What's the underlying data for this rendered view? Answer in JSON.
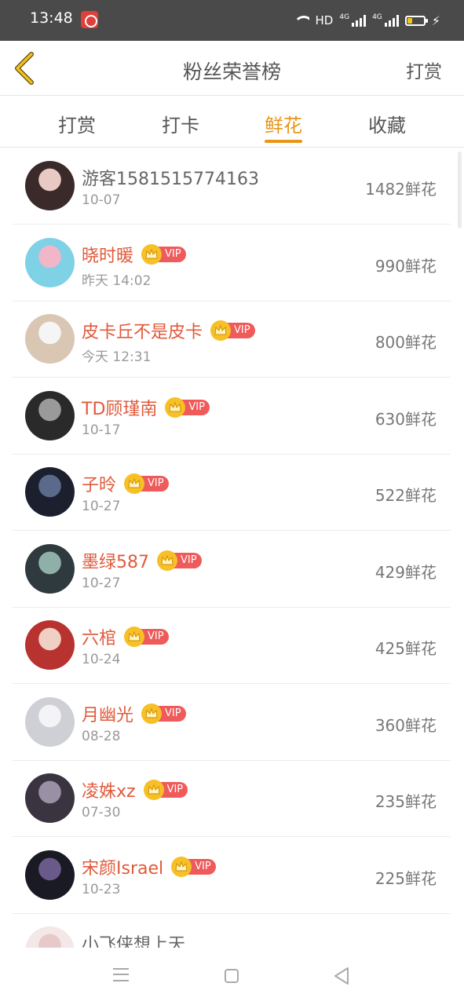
{
  "status": {
    "time": "13:48",
    "hd": "HD",
    "net1": "4G",
    "net2": "4G"
  },
  "header": {
    "title": "粉丝荣誉榜",
    "action": "打赏"
  },
  "tabs": [
    {
      "label": "打赏"
    },
    {
      "label": "打卡"
    },
    {
      "label": "鲜花",
      "active": true
    },
    {
      "label": "收藏"
    }
  ],
  "vip_label": "VIP",
  "colors": {
    "accent": "#e8951b",
    "vip_name": "#e05a3c",
    "vip_badge": "#ef5a5a",
    "crown": "#f6c026"
  },
  "rows": [
    {
      "name": "游客1581515774163",
      "vip": false,
      "date": "10-07",
      "amount": "1482鲜花"
    },
    {
      "name": "晓时暖",
      "vip": true,
      "date": "昨天 14:02",
      "amount": "990鲜花"
    },
    {
      "name": "皮卡丘不是皮卡",
      "vip": true,
      "date": "今天 12:31",
      "amount": "800鲜花"
    },
    {
      "name": "TD顾瑾南",
      "vip": true,
      "date": "10-17",
      "amount": "630鲜花"
    },
    {
      "name": "子昤",
      "vip": true,
      "date": "10-27",
      "amount": "522鲜花"
    },
    {
      "name": "墨绿587",
      "vip": true,
      "date": "10-27",
      "amount": "429鲜花"
    },
    {
      "name": "六棺",
      "vip": true,
      "date": "10-24",
      "amount": "425鲜花"
    },
    {
      "name": "月幽光",
      "vip": true,
      "date": "08-28",
      "amount": "360鲜花"
    },
    {
      "name": "凌姝xz",
      "vip": true,
      "date": "07-30",
      "amount": "235鲜花"
    },
    {
      "name": "宋颜Israel",
      "vip": true,
      "date": "10-23",
      "amount": "225鲜花"
    },
    {
      "name": "小飞侠想上天",
      "vip": false,
      "date": "",
      "amount": ""
    }
  ]
}
